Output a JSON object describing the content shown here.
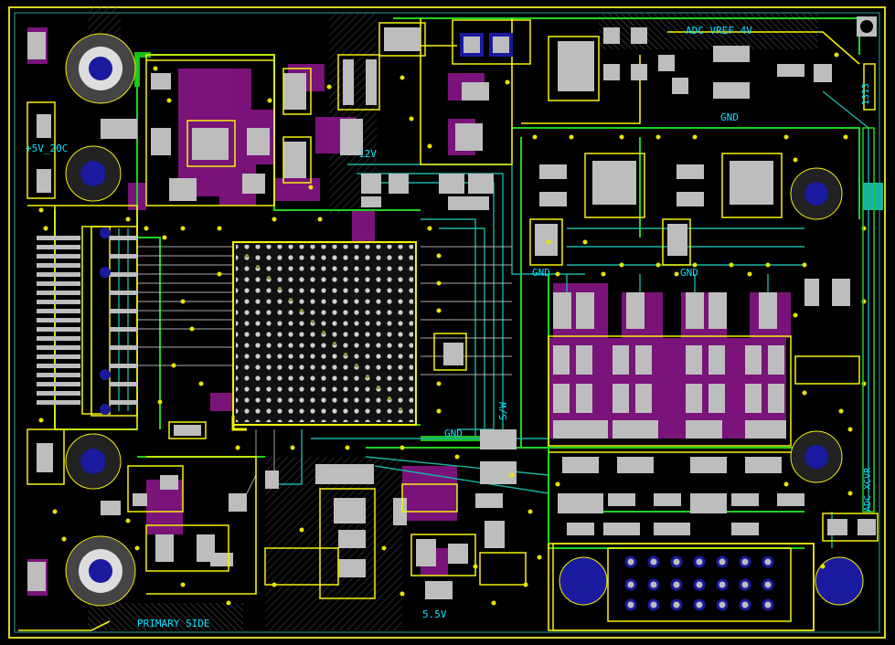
{
  "board": {
    "labels": {
      "adc_vref": "ADC VREF 4V",
      "gnd_top": "GND",
      "v12": "12V",
      "p5v_20c": "+5V_20C",
      "gnd_left": "GND",
      "gnd_mid": "GND",
      "gnd_right": "GND",
      "sw": "S/W",
      "primary_side": "PRIMARY SIDE",
      "v5_5": "5.5V",
      "vertical_right": "ADC XCVR",
      "top_right_tag": "1313"
    },
    "colors": {
      "background": "#000000",
      "board_outline": "#d6d624",
      "copper_top": "#f2f20a",
      "copper_green": "#1ed31e",
      "copper_teal": "#17b3a1",
      "copper_magenta": "#b41bb4",
      "pad_gray": "#bdbdbd",
      "via_yellow": "#e6e600",
      "mount_hole": "#1a1a9e",
      "silkscreen": "#00e5ff",
      "hatch": "#4a4a4a"
    }
  }
}
